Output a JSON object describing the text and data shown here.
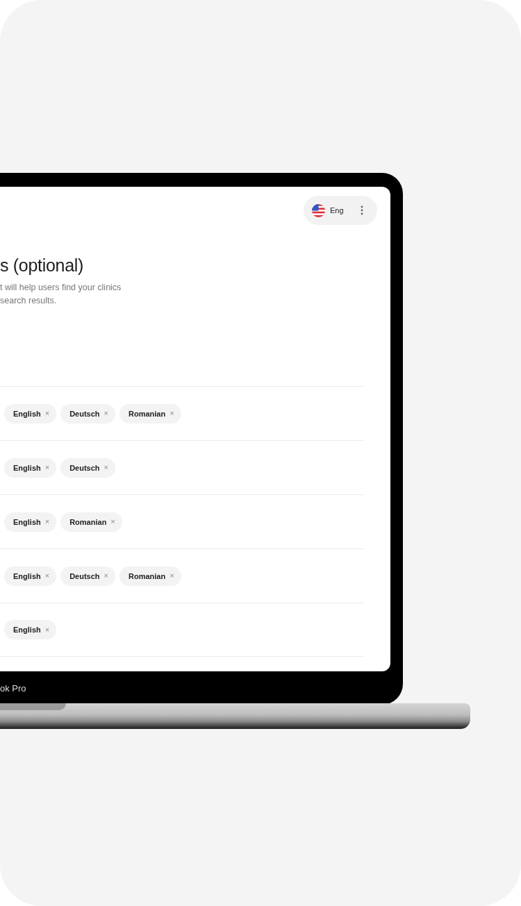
{
  "device": {
    "label": "ok Pro"
  },
  "header": {
    "language": "Eng"
  },
  "heading": "s (optional)",
  "description_lines": [
    "t will help users find your clinics",
    "search results."
  ],
  "rows": [
    {
      "chips": [
        {
          "label": "English",
          "remove": "×"
        },
        {
          "label": "Deutsch",
          "remove": "×"
        },
        {
          "label": "Romanian",
          "remove": "×"
        }
      ]
    },
    {
      "chips": [
        {
          "label": "English",
          "remove": "×"
        },
        {
          "label": "Deutsch",
          "remove": "×"
        }
      ]
    },
    {
      "chips": [
        {
          "label": "English",
          "remove": "×"
        },
        {
          "label": "Romanian",
          "remove": "×"
        }
      ]
    },
    {
      "chips": [
        {
          "label": "English",
          "remove": "×"
        },
        {
          "label": "Deutsch",
          "remove": "×"
        },
        {
          "label": "Romanian",
          "remove": "×"
        }
      ]
    },
    {
      "chips": [
        {
          "label": "English",
          "remove": "×"
        }
      ]
    }
  ]
}
